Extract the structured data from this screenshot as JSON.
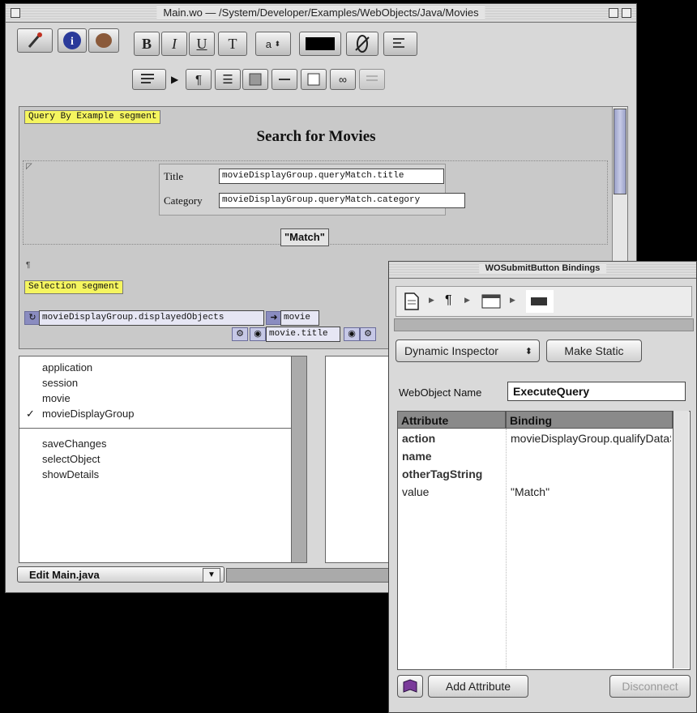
{
  "main_window": {
    "title": "Main.wo — /System/Developer/Examples/WebObjects/Java/Movies",
    "toolbar1": {
      "bold": "B",
      "italic": "I",
      "underline": "U",
      "typewriter": "T",
      "size": "a"
    },
    "toolbar2": {
      "paragraph": "¶"
    },
    "editor": {
      "qbe_label": "Query By Example segment",
      "heading": "Search for Movies",
      "title_label": "Title",
      "title_binding": "movieDisplayGroup.queryMatch.title",
      "category_label": "Category",
      "category_binding": "movieDisplayGroup.queryMatch.category",
      "match_button": "\"Match\"",
      "selection_label": "Selection segment",
      "repetition_list": "movieDisplayGroup.displayedObjects",
      "repetition_item": "movie",
      "movie_title": "movie.title"
    },
    "list_left": {
      "variables": [
        "application",
        "session",
        "movie",
        "movieDisplayGroup"
      ],
      "checked": "✓",
      "methods": [
        "saveChanges",
        "selectObject",
        "showDetails"
      ]
    },
    "popup_label": "Edit Main.java"
  },
  "inspector": {
    "title": "WOSubmitButton Bindings",
    "inspector_popup": "Dynamic Inspector",
    "make_static": "Make Static",
    "name_label": "WebObject Name",
    "name_value": "ExecuteQuery",
    "columns": [
      "Attribute",
      "Binding"
    ],
    "rows": [
      {
        "attribute": "action",
        "binding": "movieDisplayGroup.qualifyDataSource"
      },
      {
        "attribute": "name",
        "binding": ""
      },
      {
        "attribute": "otherTagString",
        "binding": ""
      },
      {
        "attribute": "value",
        "binding": "\"Match\""
      }
    ],
    "add_attribute": "Add Attribute",
    "disconnect": "Disconnect"
  }
}
